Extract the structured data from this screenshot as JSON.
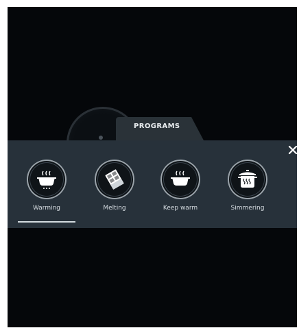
{
  "tab": {
    "label": "PROGRAMS"
  },
  "close": {
    "label": "×"
  },
  "programs": [
    {
      "label": "Warming",
      "icon": "warming-pot-icon",
      "selected": true
    },
    {
      "label": "Melting",
      "icon": "chocolate-icon",
      "selected": false
    },
    {
      "label": "Keep warm",
      "icon": "keep-warm-pot-icon",
      "selected": false
    },
    {
      "label": "Simmering",
      "icon": "simmering-pot-icon",
      "selected": false
    }
  ],
  "colors": {
    "screen_background": "#05070a",
    "panel_background": "#27313a",
    "tab_background": "#2a3238",
    "text": "#d7dde2",
    "selection_underline": "#d6dde2"
  }
}
